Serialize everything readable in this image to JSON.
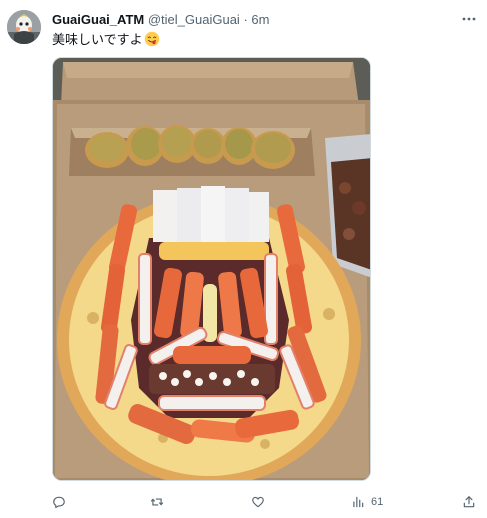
{
  "author": {
    "display_name": "GuaiGuai_ATM",
    "handle": "@tiel_GuaiGuai",
    "separator": "·",
    "time": "6m"
  },
  "tweet": {
    "text": "美味しいですよ",
    "emoji": "face-savoring-food-icon"
  },
  "actions": {
    "reply_count": "",
    "retweet_count": "",
    "like_count": "",
    "views_count": "61"
  },
  "colors": {
    "text_primary": "#0f1419",
    "text_secondary": "#536471",
    "border": "#cfd9de"
  }
}
